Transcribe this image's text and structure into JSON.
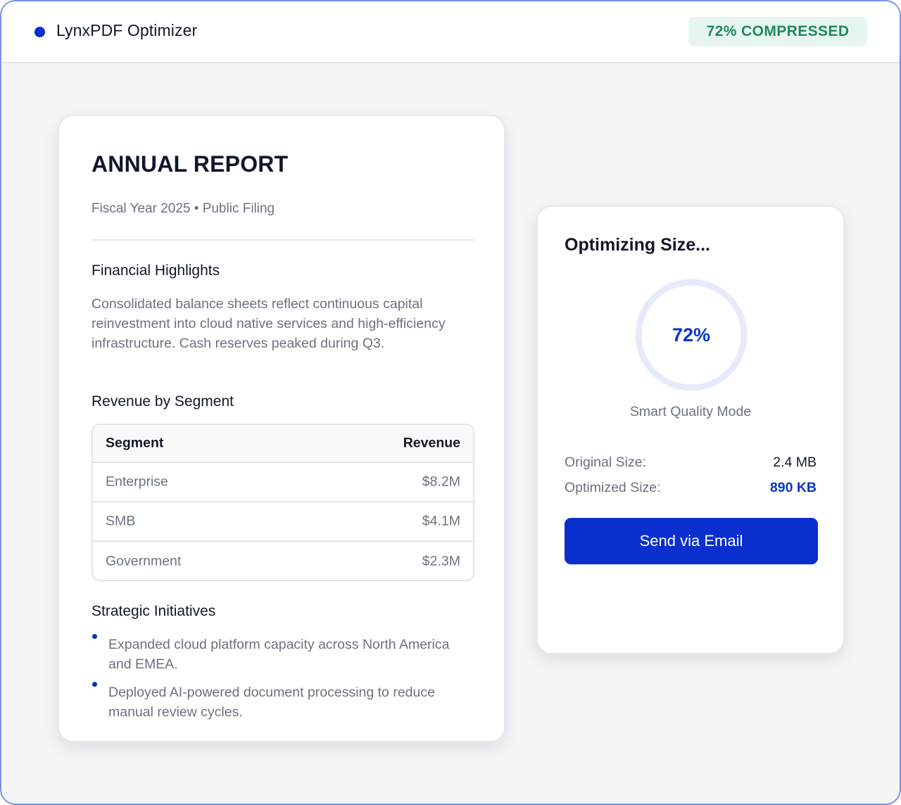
{
  "header": {
    "app_title": "LynxPDF Optimizer",
    "status_badge": "72% COMPRESSED"
  },
  "document": {
    "title": "ANNUAL REPORT",
    "subtitle": "Fiscal Year 2025 • Public Filing",
    "financial": {
      "heading": "Financial Highlights",
      "body": "Consolidated balance sheets reflect continuous capital reinvestment into cloud native services and high-efficiency infrastructure. Cash reserves peaked during Q3."
    },
    "revenue": {
      "heading": "Revenue by Segment",
      "columns": [
        "Segment",
        "Revenue"
      ],
      "rows": [
        {
          "segment": "Enterprise",
          "revenue": "$8.2M"
        },
        {
          "segment": "SMB",
          "revenue": "$4.1M"
        },
        {
          "segment": "Government",
          "revenue": "$2.3M"
        }
      ]
    },
    "initiatives": {
      "heading": "Strategic Initiatives",
      "items": [
        "Expanded cloud platform capacity across North America and EMEA.",
        "Deployed AI-powered document processing to reduce manual review cycles."
      ]
    }
  },
  "optimizer": {
    "title": "Optimizing Size...",
    "progress_label": "72%",
    "progress_fraction": 0.72,
    "mode_label": "Smart Quality Mode",
    "original_size_label": "Original Size:",
    "original_size_value": "2.4 MB",
    "optimized_size_label": "Optimized Size:",
    "optimized_size_value": "890 KB",
    "send_button_label": "Send via Email"
  },
  "colors": {
    "accent": "#0a2fcf",
    "success_text": "#1f8a5a",
    "success_bg": "#e6f6ef",
    "ring_track": "#e6ebfb"
  }
}
